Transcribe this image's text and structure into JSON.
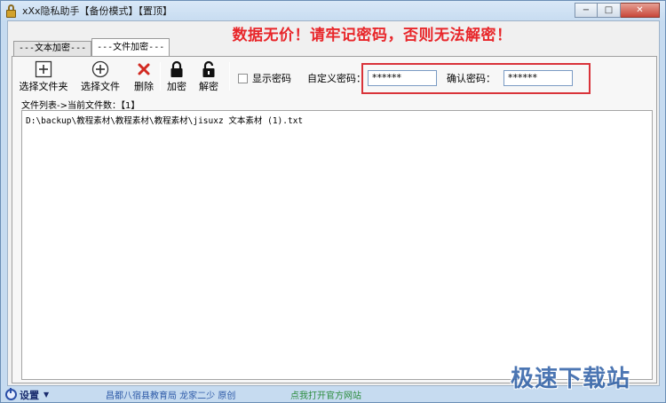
{
  "window": {
    "title": "xXx隐私助手【备份模式】【置顶】",
    "buttons": {
      "minimize": "−",
      "maximize": "□",
      "close": "✕"
    }
  },
  "warning": "数据无价！请牢记密码，否则无法解密！",
  "tabs": [
    {
      "label": "---文本加密---",
      "active": false
    },
    {
      "label": "---文件加密---",
      "active": true
    }
  ],
  "toolbar": {
    "select_folder": "选择文件夹",
    "select_file": "选择文件",
    "delete": "删除",
    "encrypt": "加密",
    "decrypt": "解密",
    "show_password": "显示密码",
    "custom_password_label": "自定义密码：",
    "custom_password_value": "******",
    "confirm_password_label": "确认密码：",
    "confirm_password_value": "******"
  },
  "file_list": {
    "count_label": "文件列表->当前文件数：【1】",
    "items": [
      "D:\\backup\\教程素材\\教程素材\\教程素材\\jisuxz 文本素材 (1).txt"
    ]
  },
  "statusbar": {
    "settings": "设置",
    "credit": "昌都八宿县教育局 龙家二少 原创",
    "official_site": "点我打开官方网站"
  },
  "watermark": "极速下载站",
  "colors": {
    "warning": "#e8262a",
    "highlight_box": "#d9333a",
    "link_green": "#2b8c3d",
    "credit_blue": "#2d5aa8"
  }
}
